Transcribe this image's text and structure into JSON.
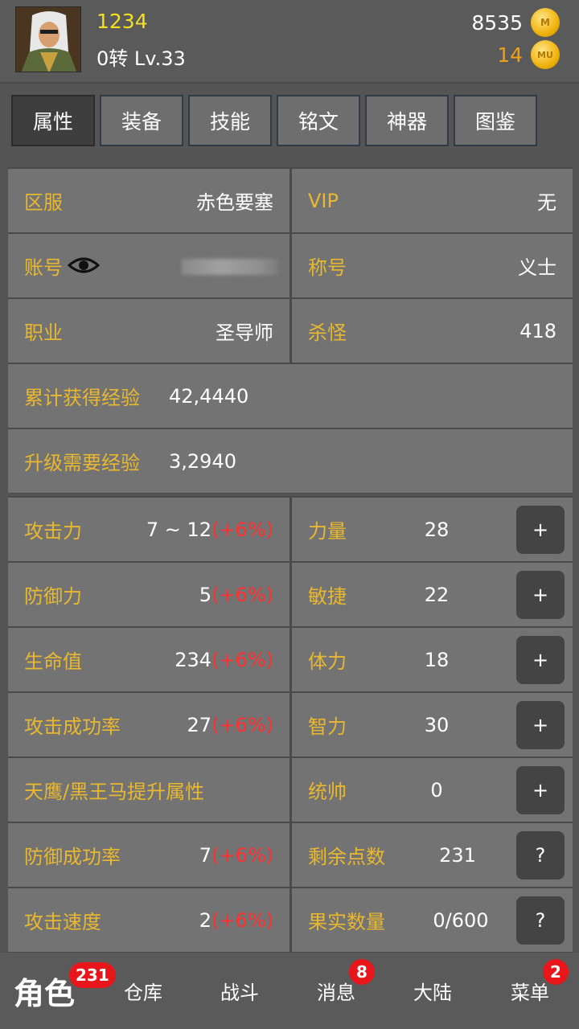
{
  "header": {
    "player_name": "1234",
    "level_text": "0转 Lv.33",
    "gold_amount": "8535",
    "gold_icon_text": "M",
    "mu_amount": "14",
    "mu_icon_text": "MU"
  },
  "tabs": [
    {
      "label": "属性",
      "active": true
    },
    {
      "label": "装备"
    },
    {
      "label": "技能"
    },
    {
      "label": "铭文"
    },
    {
      "label": "神器"
    },
    {
      "label": "图鉴"
    }
  ],
  "info": {
    "server_label": "区服",
    "server_value": "赤色要塞",
    "vip_label": "VIP",
    "vip_value": "无",
    "account_label": "账号",
    "title_label": "称号",
    "title_value": "义士",
    "class_label": "职业",
    "class_value": "圣导师",
    "kills_label": "杀怪",
    "kills_value": "418",
    "total_exp_label": "累计获得经验",
    "total_exp_value": "42,4440",
    "need_exp_label": "升级需要经验",
    "need_exp_value": "3,2940"
  },
  "stats_left": [
    {
      "label": "攻击力",
      "value": "7 ~ 12",
      "bonus": "(+6%)"
    },
    {
      "label": "防御力",
      "value": "5",
      "bonus": "(+6%)"
    },
    {
      "label": "生命值",
      "value": "234",
      "bonus": "(+6%)"
    },
    {
      "label": "攻击成功率",
      "value": "27",
      "bonus": "(+6%)"
    },
    {
      "label": "天鹰/黑王马提升属性",
      "value": "",
      "bonus": ""
    },
    {
      "label": "防御成功率",
      "value": "7",
      "bonus": "(+6%)"
    },
    {
      "label": "攻击速度",
      "value": "2",
      "bonus": "(+6%)"
    }
  ],
  "stats_right": [
    {
      "label": "力量",
      "value": "28",
      "button": "+"
    },
    {
      "label": "敏捷",
      "value": "22",
      "button": "+"
    },
    {
      "label": "体力",
      "value": "18",
      "button": "+"
    },
    {
      "label": "智力",
      "value": "30",
      "button": "+"
    },
    {
      "label": "统帅",
      "value": "0",
      "button": "+"
    },
    {
      "label": "剩余点数",
      "value": "231",
      "button": "?"
    },
    {
      "label": "果实数量",
      "value": "0/600",
      "button": "?"
    }
  ],
  "nav": [
    {
      "label": "角色",
      "badge": "231"
    },
    {
      "label": "仓库",
      "badge": ""
    },
    {
      "label": "战斗",
      "badge": ""
    },
    {
      "label": "消息",
      "badge": "8"
    },
    {
      "label": "大陆",
      "badge": ""
    },
    {
      "label": "菜单",
      "badge": "2"
    }
  ]
}
